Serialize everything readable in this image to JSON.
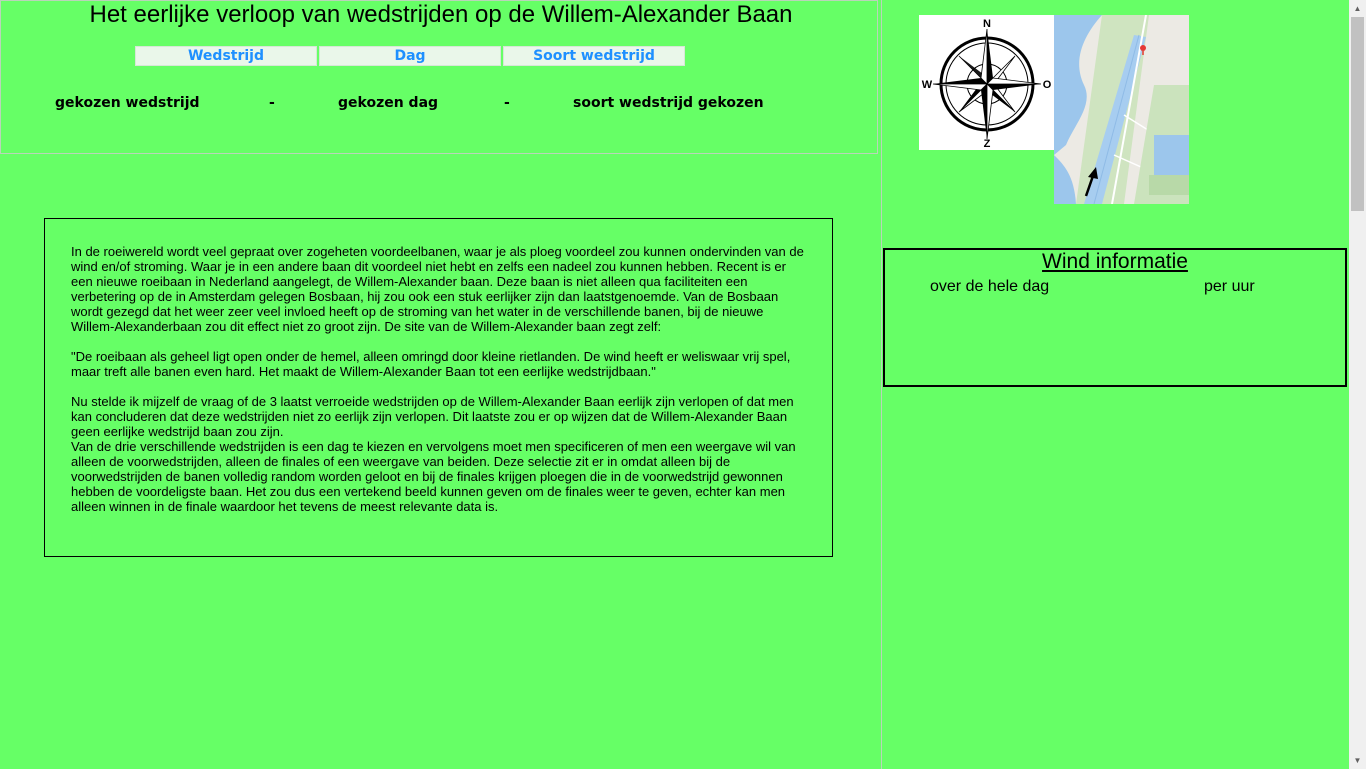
{
  "header": {
    "title": "Het eerlijke verloop van wedstrijden op de Willem-Alexander Baan",
    "nav": [
      "Wedstrijd",
      "Dag",
      "Soort wedstrijd"
    ],
    "selection": {
      "race": "gekozen wedstrijd",
      "sep1": "-",
      "day": "gekozen dag",
      "sep2": "-",
      "type": "soort wedstrijd gekozen"
    }
  },
  "intro": {
    "p1": "In de roeiwereld wordt veel gepraat over zogeheten voordeelbanen, waar je als ploeg voordeel zou kunnen ondervinden van de wind en/of stroming. Waar je in een andere baan dit voordeel niet hebt en zelfs een nadeel zou kunnen hebben. Recent is er een nieuwe roeibaan in Nederland aangelegt, de Willem-Alexander baan. Deze baan is niet alleen qua faciliteiten een verbetering op de in Amsterdam gelegen Bosbaan, hij zou ook een stuk eerlijker zijn dan laatstgenoemde. Van de Bosbaan wordt gezegd dat het weer zeer veel invloed heeft op de stroming van het water in de verschillende banen, bij de nieuwe Willem-Alexanderbaan zou dit effect niet zo groot zijn. De site van de Willem-Alexander baan zegt zelf:",
    "p2": "\"De roeibaan als geheel ligt open onder de hemel, alleen omringd door kleine rietlanden. De wind heeft er weliswaar vrij spel, maar treft alle banen even hard. Het maakt de Willem-Alexander Baan tot een eerlijke wedstrijdbaan.\"",
    "p3": "Nu stelde ik mijzelf de vraag of de 3 laatst verroeide wedstrijden op de Willem-Alexander Baan eerlijk zijn verlopen of dat men kan concluderen dat deze wedstrijden niet zo eerlijk zijn verlopen. Dit laatste zou er op wijzen dat de Willem-Alexander Baan geen eerlijke wedstrijd baan zou zijn.",
    "p4": "Van de drie verschillende wedstrijden is een dag te kiezen en vervolgens moet men specificeren of men een weergave wil van alleen de voorwedstrijden, alleen de finales of een weergave van beiden. Deze selectie zit er in omdat alleen bij de voorwedstrijden de banen volledig random worden geloot en bij de finales krijgen ploegen die in de voorwedstrijd gewonnen hebben de voordeligste baan. Het zou dus een vertekend beeld kunnen geven om de finales weer te geven, echter kan men alleen winnen in de finale waardoor het tevens de meest relevante data is."
  },
  "compass": {
    "n": "N",
    "z": "Z",
    "w": "W",
    "o": "O"
  },
  "wind": {
    "title": "Wind informatie",
    "day_label": "over de hele dag",
    "hour_label": "per uur"
  },
  "icons": {
    "compass": "compass-rose-icon",
    "map": "course-map",
    "arrow": "wind-direction-arrow-icon",
    "marker": "map-pin-icon"
  }
}
